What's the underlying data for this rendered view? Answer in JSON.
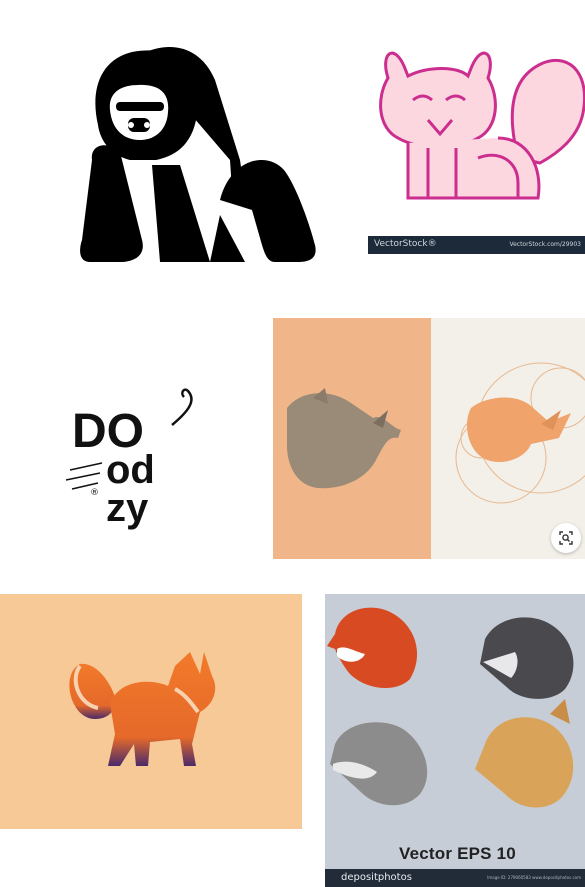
{
  "tiles": {
    "gorilla": {
      "name": "gorilla-logo"
    },
    "squirrel": {
      "watermark_left": "VectorStock®",
      "watermark_right": "VectorStock.com/29903"
    },
    "doodzy": {
      "line1": "DO",
      "line2": "od",
      "line3": "zy",
      "reg_mark": "®"
    },
    "rhino": {
      "lens_icon": "visual-search-icon"
    },
    "fox": {
      "name": "fox-logo"
    },
    "animals_pack": {
      "title": "Vector EPS 10",
      "brand": "depositphotos",
      "meta": "Image ID: 279060583   www.depositphotos.com"
    }
  },
  "colors": {
    "peach_bg": "#f6c997",
    "rhino_orange": "#f0b689",
    "pink_fill": "#fcd7df",
    "magenta_line": "#cc2e8f",
    "blue_gray_bg": "#c7cdd6"
  }
}
